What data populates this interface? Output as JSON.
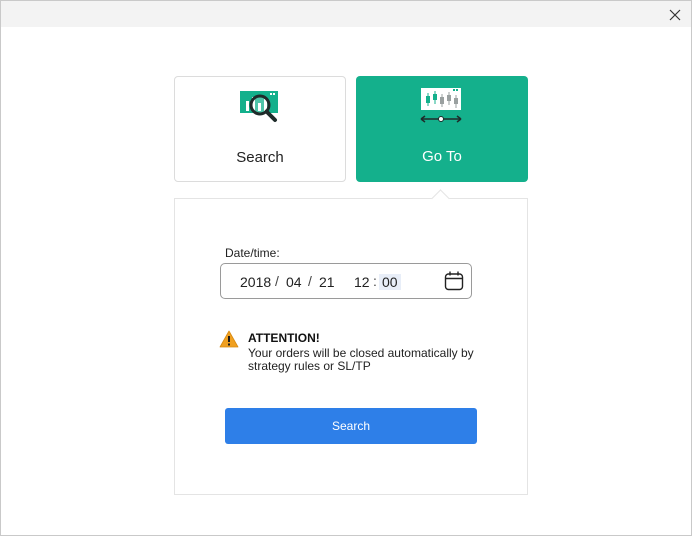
{
  "window": {
    "close_glyph": "✕"
  },
  "tabs": {
    "search": {
      "label": "Search",
      "icon": "chart-magnifier-icon"
    },
    "goto": {
      "label": "Go To",
      "icon": "candlestick-timeline-icon",
      "active": true
    }
  },
  "datetime": {
    "label": "Date/time:",
    "year": "2018",
    "month": "04",
    "day": "21",
    "hour": "12",
    "minute": "00",
    "date_separator": "/",
    "time_separator": ":"
  },
  "attention": {
    "title": "ATTENTION!",
    "message": "Your orders will be closed automatically by strategy rules or SL/TP"
  },
  "actions": {
    "search_label": "Search"
  },
  "colors": {
    "accent": "#14b08c",
    "button": "#2e7fe8",
    "warning": "#f0a020"
  }
}
